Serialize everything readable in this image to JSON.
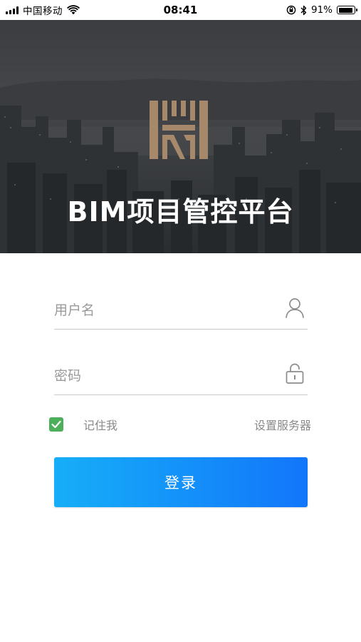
{
  "status_bar": {
    "carrier": "中国移动",
    "time": "08:41",
    "battery_text": "91%",
    "battery_level": 0.91,
    "icons": [
      "signal-bars-icon",
      "wifi-icon",
      "orientation-lock-icon",
      "bluetooth-icon",
      "battery-icon"
    ]
  },
  "hero": {
    "title": "BIM项目管控平台",
    "logo": "brand-logo-icon",
    "logo_color": "#a5896a"
  },
  "login_form": {
    "username": {
      "value": "",
      "placeholder": "用户名",
      "icon": "user-icon"
    },
    "password": {
      "value": "",
      "placeholder": "密码",
      "icon": "lock-icon"
    },
    "remember_me": {
      "label": "记住我",
      "checked": true,
      "color": "#4cb05a"
    },
    "server_settings_label": "设置服务器",
    "login_label": "登录",
    "login_colors": [
      "#16aef8",
      "#1276fb"
    ]
  }
}
